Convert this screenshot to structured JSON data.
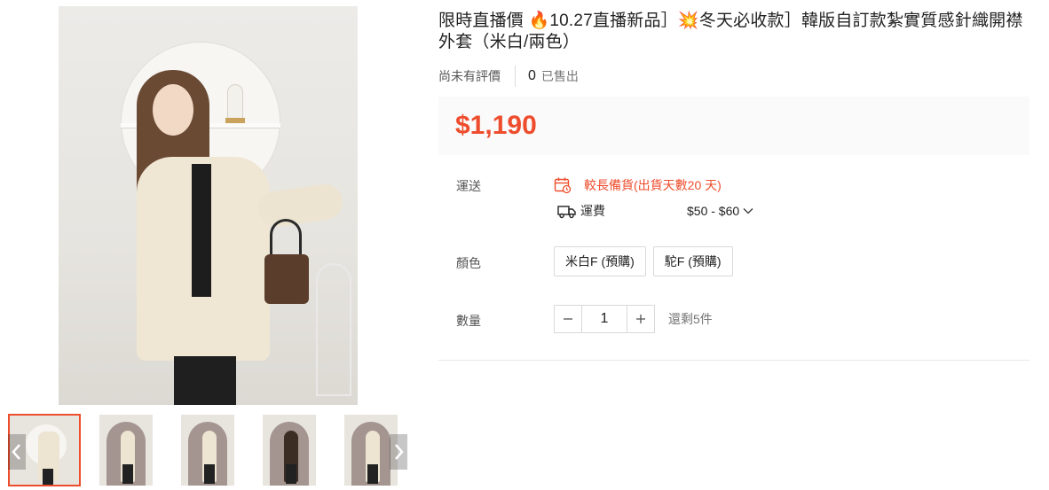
{
  "product": {
    "title": "限時直播價 🔥10.27直播新品］💥冬天必收款］韓版自訂款紮實質感針織開襟外套（米白/兩色）",
    "no_rating_text": "尚未有評價",
    "sold_count": "0",
    "sold_label": "已售出",
    "price": "$1,190"
  },
  "shipping": {
    "label": "運送",
    "lead_time_text": "較長備貨(出貨天數20 天)",
    "fee_label": "運費",
    "fee_value": "$50 - $60"
  },
  "color": {
    "label": "顏色",
    "options": [
      "米白F (預購)",
      "駝F (預購)"
    ]
  },
  "quantity": {
    "label": "數量",
    "value": "1",
    "stock_text": "還剩5件"
  },
  "gallery": {
    "thumbnails": 5,
    "active_index": 0
  },
  "colors": {
    "accent": "#ee4d2d",
    "price_bg": "#fafafa"
  },
  "icons": {
    "prev": "chevron-left-icon",
    "next": "chevron-right-icon",
    "calendar": "calendar-clock-icon",
    "truck": "truck-icon",
    "chevron": "chevron-down-icon",
    "minus": "minus-icon",
    "plus": "plus-icon"
  }
}
